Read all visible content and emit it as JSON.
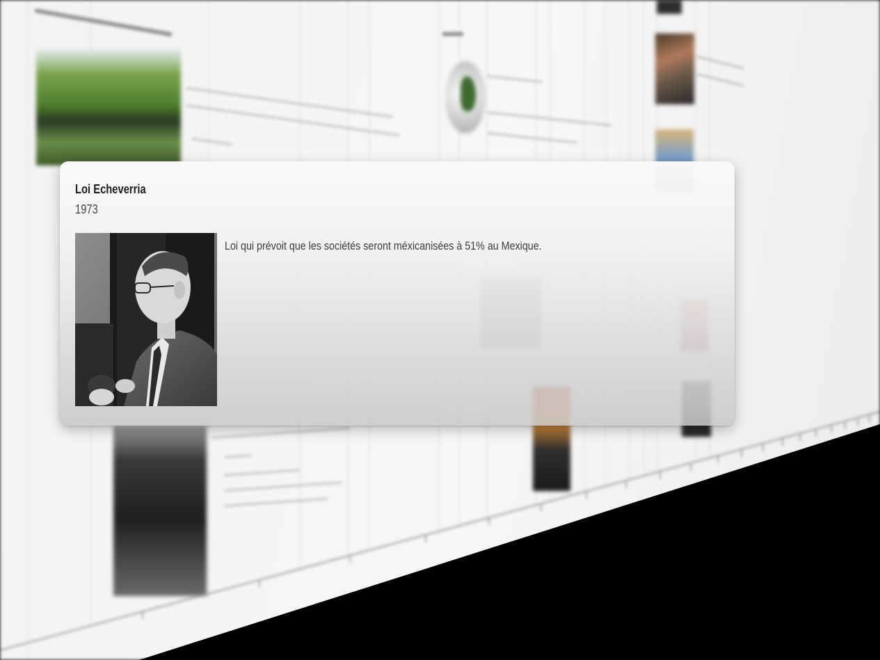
{
  "event": {
    "title": "Loi Echeverria",
    "year": "1973",
    "description": "Loi qui prévoit que les sociétés seront méxicanisées à 51% au Mexique.",
    "photo": "portrait-photo"
  },
  "background": {
    "style": "blurred-perspective-timeline",
    "colors": {
      "plane": "#f3f3f3",
      "void": "#000000",
      "axis": "#9a9a9a"
    }
  }
}
